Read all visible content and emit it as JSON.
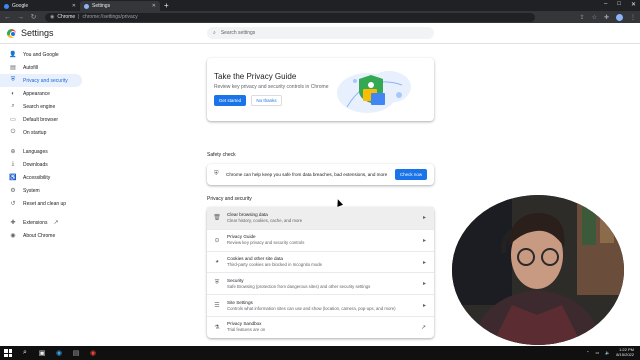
{
  "browser": {
    "tabs": [
      {
        "title": "Google",
        "active": false
      },
      {
        "title": "Settings",
        "active": true
      }
    ],
    "new_tab": "+",
    "address": {
      "host": "Chrome",
      "path": "chrome://settings/privacy"
    },
    "window_controls": [
      "–",
      "□",
      "✕"
    ]
  },
  "settings": {
    "title": "Settings",
    "search_placeholder": "Search settings",
    "sidebar": [
      {
        "label": "You and Google",
        "icon": "person-icon",
        "glyph": "👤"
      },
      {
        "label": "Autofill",
        "icon": "clipboard-icon",
        "glyph": "▤"
      },
      {
        "label": "Privacy and security",
        "icon": "shield-icon",
        "glyph": "⛨"
      },
      {
        "label": "Appearance",
        "icon": "palette-icon",
        "glyph": "◐"
      },
      {
        "label": "Search engine",
        "icon": "search-icon",
        "glyph": "⌕"
      },
      {
        "label": "Default browser",
        "icon": "browser-icon",
        "glyph": "▭"
      },
      {
        "label": "On startup",
        "icon": "power-icon",
        "glyph": "⏻"
      },
      {
        "label": "Languages",
        "icon": "globe-icon",
        "glyph": "⊕"
      },
      {
        "label": "Downloads",
        "icon": "download-icon",
        "glyph": "⤓"
      },
      {
        "label": "Accessibility",
        "icon": "accessibility-icon",
        "glyph": "♿"
      },
      {
        "label": "System",
        "icon": "wrench-icon",
        "glyph": "⚙"
      },
      {
        "label": "Reset and clean up",
        "icon": "history-icon",
        "glyph": "↺"
      },
      {
        "label": "Extensions",
        "icon": "puzzle-icon",
        "glyph": "✚"
      },
      {
        "label": "About Chrome",
        "icon": "chrome-icon",
        "glyph": "◉"
      }
    ],
    "privacy_guide": {
      "title": "Take the Privacy Guide",
      "description": "Review key privacy and security controls in Chrome",
      "primary_label": "Get started",
      "secondary_label": "No thanks"
    },
    "safety_check": {
      "heading": "Safety check",
      "text": "Chrome can help keep you safe from data breaches, bad extensions, and more",
      "button_label": "Check now"
    },
    "privacy_section": {
      "heading": "Privacy and security",
      "rows": [
        {
          "title": "Clear browsing data",
          "subtitle": "Clear history, cookies, cache, and more",
          "icon": "trash-icon",
          "glyph": "🗑",
          "arrow": "▸"
        },
        {
          "title": "Privacy Guide",
          "subtitle": "Review key privacy and security controls",
          "icon": "compass-icon",
          "glyph": "⊙",
          "arrow": "▸"
        },
        {
          "title": "Cookies and other site data",
          "subtitle": "Third-party cookies are blocked in Incognito mode",
          "icon": "cookie-icon",
          "glyph": "◕",
          "arrow": "▸"
        },
        {
          "title": "Security",
          "subtitle": "Safe Browsing (protection from dangerous sites) and other security settings",
          "icon": "shield-icon",
          "glyph": "⛨",
          "arrow": "▸"
        },
        {
          "title": "Site Settings",
          "subtitle": "Controls what information sites can use and show (location, camera, pop-ups, and more)",
          "icon": "sliders-icon",
          "glyph": "☰",
          "arrow": "▸"
        },
        {
          "title": "Privacy Sandbox",
          "subtitle": "Trial features are on",
          "icon": "flask-icon",
          "glyph": "⚗",
          "arrow": "↗"
        }
      ]
    }
  },
  "taskbar": {
    "time": "1:22 PM",
    "date": "8/15/2022"
  },
  "colors": {
    "accent": "#1a73e8",
    "active_nav_bg": "#e8f0fe",
    "page_bg": "#ffffff"
  }
}
